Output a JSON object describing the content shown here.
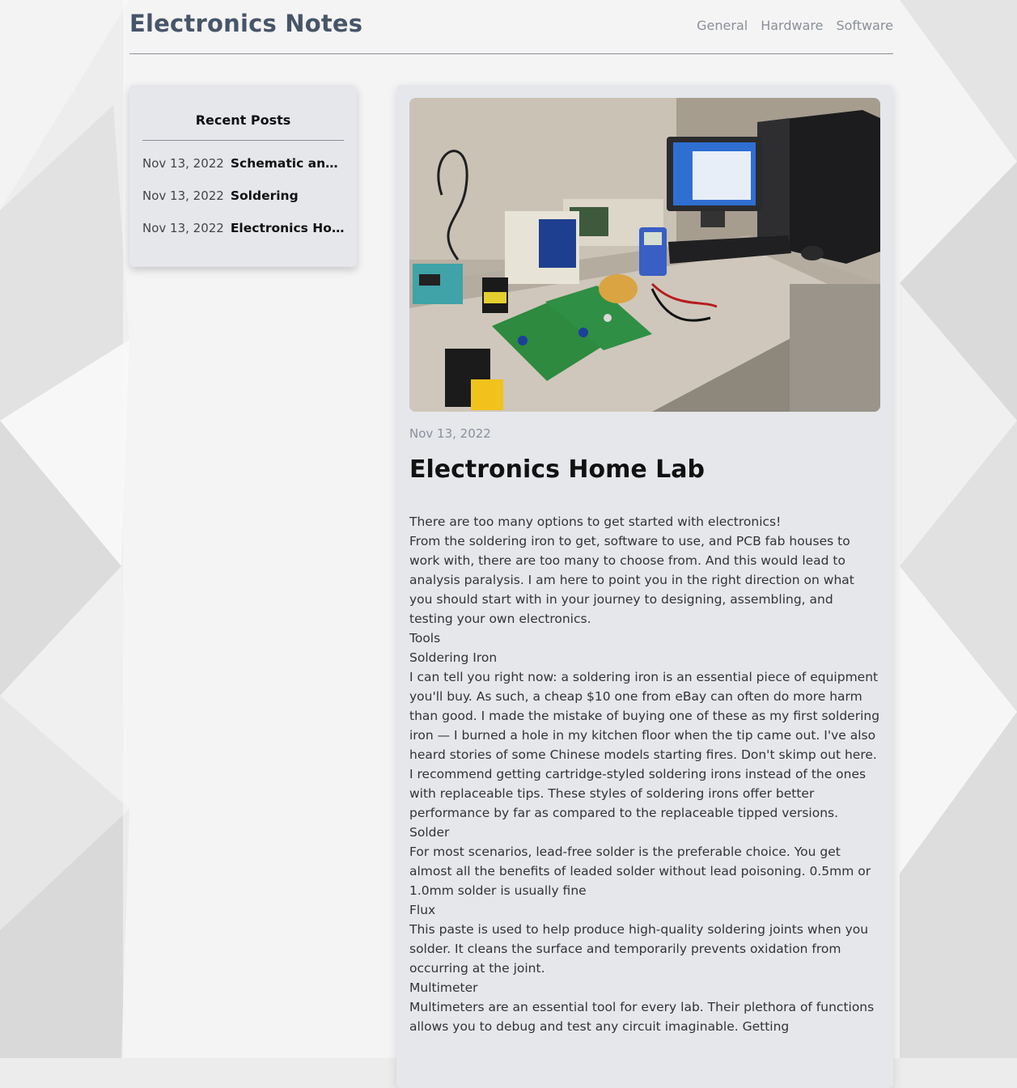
{
  "site": {
    "title": "Electronics Notes"
  },
  "nav": {
    "items": [
      "General",
      "Hardware",
      "Software"
    ]
  },
  "sidebar": {
    "heading": "Recent Posts",
    "posts": [
      {
        "date": "Nov 13, 2022",
        "title": "Schematic and PCB Design"
      },
      {
        "date": "Nov 13, 2022",
        "title": "Soldering"
      },
      {
        "date": "Nov 13, 2022",
        "title": "Electronics Home Lab"
      }
    ]
  },
  "article": {
    "date": "Nov 13, 2022",
    "title": "Electronics Home Lab",
    "paragraphs": [
      "There are too many options to get started with electronics!",
      "From the soldering iron to get, software to use, and PCB fab houses to work with, there are too many to choose from. And this would lead to analysis paralysis. I am here to point you in the right direction on what you should start with in your journey to designing, assembling, and testing your own electronics.",
      "Tools",
      "Soldering Iron",
      "I can tell you right now: a soldering iron is an essential piece of equipment you'll buy. As such, a cheap $10 one from eBay can often do more harm than good. I made the mistake of buying one of these as my first soldering iron — I burned a hole in my kitchen floor when the tip came out. I've also heard stories of some Chinese models starting fires. Don't skimp out here. I recommend getting cartridge-styled soldering irons instead of the ones with replaceable tips. These styles of soldering irons offer better performance by far as compared to the replaceable tipped versions.",
      "Solder",
      "For most scenarios, lead-free solder is the preferable choice. You get almost all the benefits of leaded solder without lead poisoning. 0.5mm or 1.0mm solder is usually fine",
      "Flux",
      "This paste is used to help produce high-quality soldering joints when you solder. It cleans the surface and temporarily prevents oxidation from occurring at the joint.",
      "Multimeter",
      "Multimeters are an essential tool for every lab. Their plethora of functions allows you to debug and test any circuit imaginable. Getting"
    ]
  }
}
